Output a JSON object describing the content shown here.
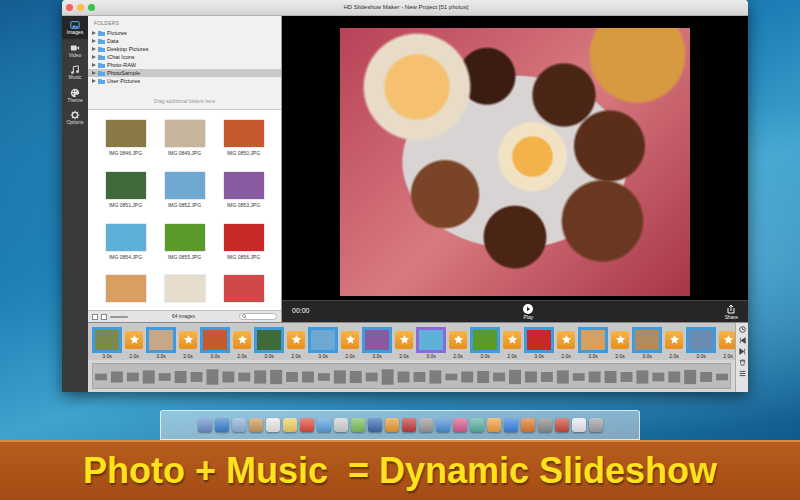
{
  "window": {
    "title": "HD Slideshow Maker - New Project [51 photos]"
  },
  "sidebar": {
    "items": [
      {
        "label": "Images",
        "selected": true
      },
      {
        "label": "Video",
        "selected": false
      },
      {
        "label": "Music",
        "selected": false
      },
      {
        "label": "Theme",
        "selected": false
      },
      {
        "label": "Options",
        "selected": false
      }
    ]
  },
  "folders": {
    "heading": "FOLDERS",
    "items": [
      {
        "label": "Pictures",
        "selected": false
      },
      {
        "label": "Data",
        "selected": false
      },
      {
        "label": "Desktop Pictures",
        "selected": false
      },
      {
        "label": "iChat Icons",
        "selected": false
      },
      {
        "label": "Photo-RAW",
        "selected": false
      },
      {
        "label": "PhotoSample",
        "selected": true
      },
      {
        "label": "User Pictures",
        "selected": false
      }
    ],
    "hint": "Drag additional folders here"
  },
  "thumbnails": {
    "count": "64 images",
    "items": [
      {
        "label": "IMG 0846.JPG",
        "color": "#8a7a4a"
      },
      {
        "label": "IMG 0849.JPG",
        "color": "#c6b49c"
      },
      {
        "label": "IMG 0850.JPG",
        "color": "#c65a2e"
      },
      {
        "label": "IMG 0851.JPG",
        "color": "#3f6a3a"
      },
      {
        "label": "IMG 0852.JPG",
        "color": "#6fa8d0"
      },
      {
        "label": "IMG 0853.JPG",
        "color": "#8a5aa0"
      },
      {
        "label": "IMG 0854.JPG",
        "color": "#5fb0d8"
      },
      {
        "label": "IMG 0855.JPG",
        "color": "#5a9a2a"
      },
      {
        "label": "IMG 0856.JPG",
        "color": "#c82a2a"
      },
      {
        "color": "#d8a060"
      },
      {
        "color": "#e6ddcc"
      },
      {
        "color": "#d04848"
      }
    ]
  },
  "preview": {
    "time": "00:00",
    "play": "Play",
    "share": "Share"
  },
  "timeline": {
    "items": [
      {
        "kind": "photo",
        "duration": "3.0s",
        "selected": false,
        "color": "#7a8a4c"
      },
      {
        "kind": "transition",
        "duration": "2.0s",
        "selected": false
      },
      {
        "kind": "photo",
        "duration": "3.0s",
        "selected": false,
        "color": "#c6a888"
      },
      {
        "kind": "transition",
        "duration": "2.0s",
        "selected": false
      },
      {
        "kind": "photo",
        "duration": "3.0s",
        "selected": false,
        "color": "#c65a2e"
      },
      {
        "kind": "transition",
        "duration": "2.0s",
        "selected": false
      },
      {
        "kind": "photo",
        "duration": "3.0s",
        "selected": false,
        "color": "#3f6a3a"
      },
      {
        "kind": "transition",
        "duration": "2.0s",
        "selected": false
      },
      {
        "kind": "photo",
        "duration": "3.0s",
        "selected": false,
        "color": "#6fa8d0"
      },
      {
        "kind": "transition",
        "duration": "2.0s",
        "selected": false
      },
      {
        "kind": "photo",
        "duration": "3.0s",
        "selected": false,
        "color": "#8a5aa0"
      },
      {
        "kind": "transition",
        "duration": "2.0s",
        "selected": false
      },
      {
        "kind": "photo",
        "duration": "3.0s",
        "selected": true,
        "color": "#5fb0d8"
      },
      {
        "kind": "transition",
        "duration": "2.0s",
        "selected": false
      },
      {
        "kind": "photo",
        "duration": "3.0s",
        "selected": false,
        "color": "#5a9a2a"
      },
      {
        "kind": "transition",
        "duration": "2.0s",
        "selected": false
      },
      {
        "kind": "photo",
        "duration": "3.0s",
        "selected": false,
        "color": "#c82a2a"
      },
      {
        "kind": "transition",
        "duration": "2.0s",
        "selected": false
      },
      {
        "kind": "photo",
        "duration": "3.0s",
        "selected": false,
        "color": "#d8a060"
      },
      {
        "kind": "transition",
        "duration": "2.0s",
        "selected": false
      },
      {
        "kind": "photo",
        "duration": "3.0s",
        "selected": false,
        "color": "#b08a60"
      },
      {
        "kind": "transition",
        "duration": "2.0s",
        "selected": false
      },
      {
        "kind": "photo",
        "duration": "3.0s",
        "selected": false,
        "color": "#6a8ab0"
      },
      {
        "kind": "transition",
        "duration": "2.0s",
        "selected": false
      }
    ]
  },
  "audio": {
    "levels": [
      0.3,
      0.5,
      0.4,
      0.6,
      0.35,
      0.55,
      0.45,
      0.7,
      0.5,
      0.4,
      0.6,
      0.65,
      0.45,
      0.5,
      0.35,
      0.6,
      0.55,
      0.4,
      0.7,
      0.5,
      0.45,
      0.6,
      0.3,
      0.5,
      0.55,
      0.4,
      0.65,
      0.5,
      0.45,
      0.6,
      0.35,
      0.5,
      0.55,
      0.45,
      0.6,
      0.4,
      0.5,
      0.65,
      0.45,
      0.3
    ]
  },
  "dock": {
    "items": [
      {
        "color": "#6a8fc8"
      },
      {
        "color": "#3a7fd0"
      },
      {
        "color": "#8fb0d8"
      },
      {
        "color": "#c89a5a"
      },
      {
        "color": "#e8e8e8"
      },
      {
        "color": "#f0d060"
      },
      {
        "color": "#e04a3a"
      },
      {
        "color": "#5aa0e0"
      },
      {
        "color": "#d0d0d0"
      },
      {
        "color": "#7ac05a"
      },
      {
        "color": "#3a6ab0"
      },
      {
        "color": "#e89a30"
      },
      {
        "color": "#c03a3a"
      },
      {
        "color": "#9a9a9a"
      },
      {
        "color": "#4a90d8"
      },
      {
        "color": "#d85a8a"
      },
      {
        "color": "#5ab0a0"
      },
      {
        "color": "#f0a040"
      },
      {
        "color": "#3a80e0"
      },
      {
        "color": "#e07a30"
      },
      {
        "color": "#8a8a8a"
      },
      {
        "color": "#c84a3a"
      },
      {
        "color": "#e8e8f0"
      },
      {
        "color": "#a0a0a8"
      }
    ]
  },
  "banner": "Photo + Music  = Dynamic Slideshow"
}
